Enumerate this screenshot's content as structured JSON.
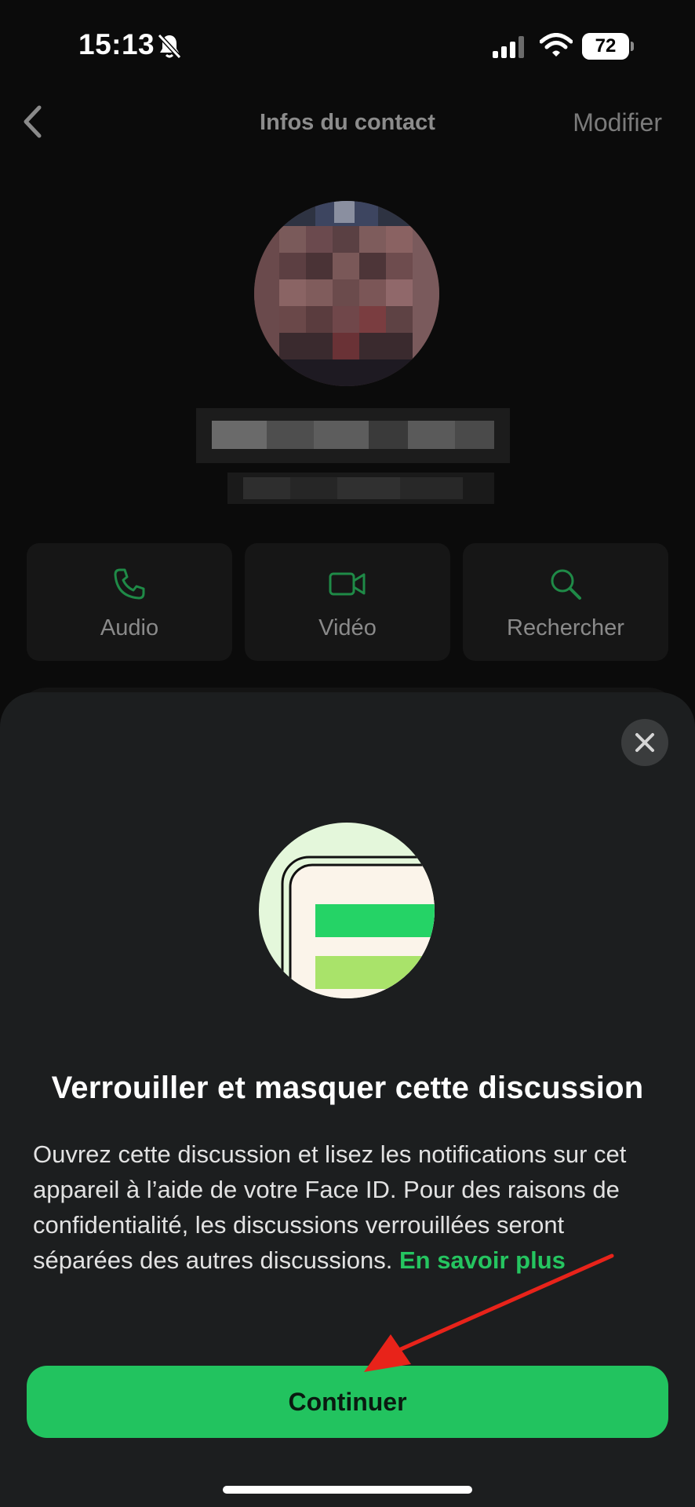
{
  "status_bar": {
    "time": "15:13",
    "battery": "72",
    "battery_level": 0.72,
    "icons": [
      "bell-slash-icon",
      "cellular-signal-icon",
      "wifi-icon",
      "battery-icon"
    ]
  },
  "nav": {
    "back_icon": "chevron-left-icon",
    "title": "Infos du contact",
    "edit_label": "Modifier"
  },
  "contact": {
    "avatar": "pixelated-avatar",
    "name_hidden": true
  },
  "actions": [
    {
      "label": "Audio",
      "icon": "phone-icon"
    },
    {
      "label": "Vidéo",
      "icon": "video-camera-icon"
    },
    {
      "label": "Rechercher",
      "icon": "magnifier-icon"
    }
  ],
  "sheet": {
    "close_icon": "close-icon",
    "illustration": "locked-chat-illustration",
    "title": "Verrouiller et masquer cette discussion",
    "body": "Ouvrez cette discussion et lisez les notifications sur cet appareil à l’aide de votre Face ID. Pour des raisons de confidentialité, les discussions verrouillées seront séparées des autres discussions. ",
    "link": "En savoir plus",
    "continue_label": "Continuer"
  },
  "colors": {
    "accent": "#25c560",
    "button": "#22c35f",
    "sheet_bg": "#1c1e1f",
    "annotation_arrow": "#e8231a"
  }
}
